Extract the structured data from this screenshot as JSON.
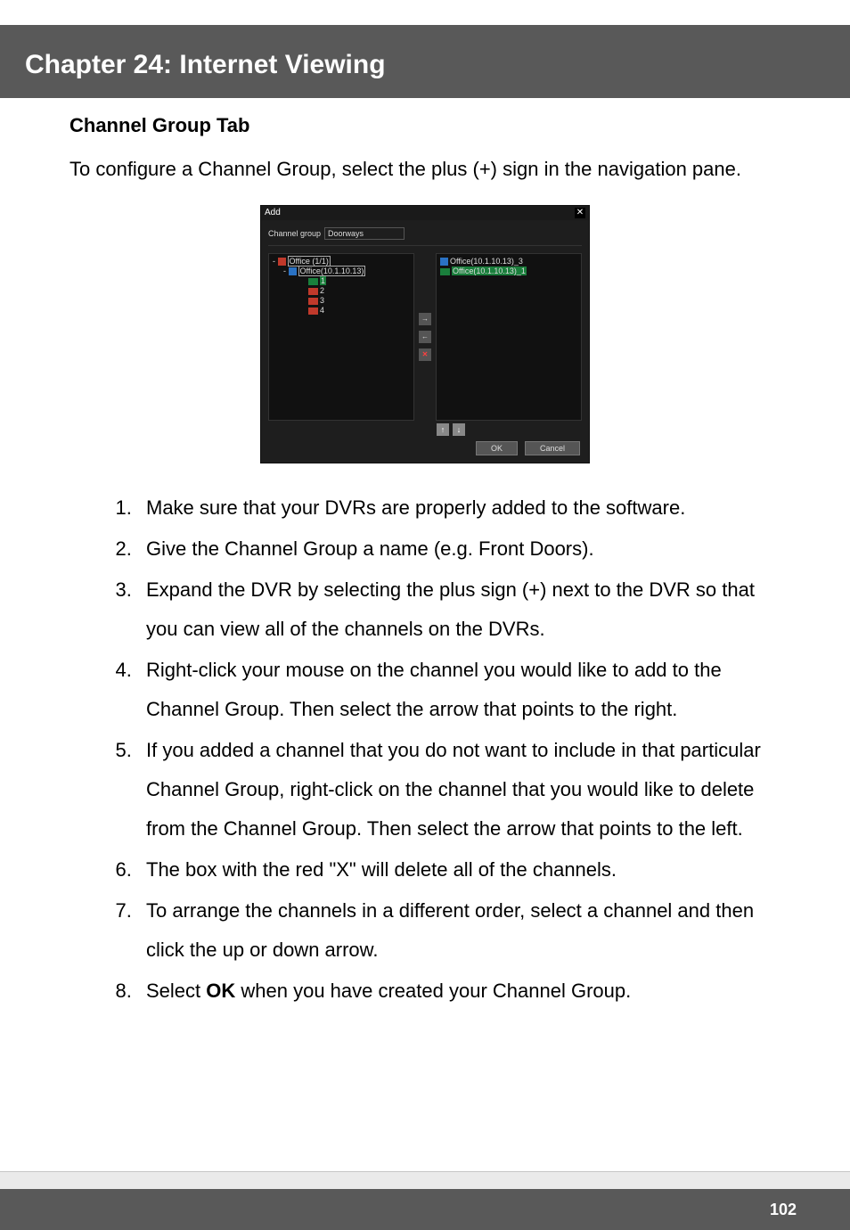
{
  "header": {
    "title": "Chapter 24: Internet Viewing"
  },
  "section": {
    "title": "Channel Group Tab"
  },
  "intro": "To configure a Channel Group, select the plus (+) sign in the navigation pane.",
  "dialog": {
    "title": "Add",
    "close": "✕",
    "channel_group_label": "Channel group",
    "channel_group_value": "Doorways",
    "tree": {
      "root": "Office (1/1)",
      "dvr": "Office(10.1.10.13)",
      "ch1": "1",
      "ch2": "2",
      "ch3": "3",
      "ch4": "4"
    },
    "mid": {
      "right": "→",
      "left": "←",
      "delete": "✕"
    },
    "right_list": {
      "item1": "Office(10.1.10.13)_3",
      "item2": "Office(10.1.10.13)_1"
    },
    "reorder": {
      "up": "↑",
      "down": "↓"
    },
    "ok": "OK",
    "cancel": "Cancel"
  },
  "steps": {
    "s1": "Make sure that your DVRs are properly added to the software.",
    "s2": "Give the Channel Group a name (e.g. Front Doors).",
    "s3": "Expand the DVR by selecting the plus sign (+) next to the DVR so that you can view all of the channels on the DVRs.",
    "s4": "Right-click your mouse on the channel you would like to add to the Channel Group. Then select the arrow that points to the right.",
    "s5": "If you added a channel that you do not want to include in that particular Channel Group, right-click on the channel that you would like to delete from the Channel Group. Then select the arrow that points to the left.",
    "s6": "The box with the red \"X\" will delete all of the channels.",
    "s7": "To arrange the channels in a different order, select a channel and then click the up or down arrow.",
    "s8_a": "Select ",
    "s8_b": "OK",
    "s8_c": " when you have created your Channel Group."
  },
  "footer": {
    "page": "102"
  }
}
